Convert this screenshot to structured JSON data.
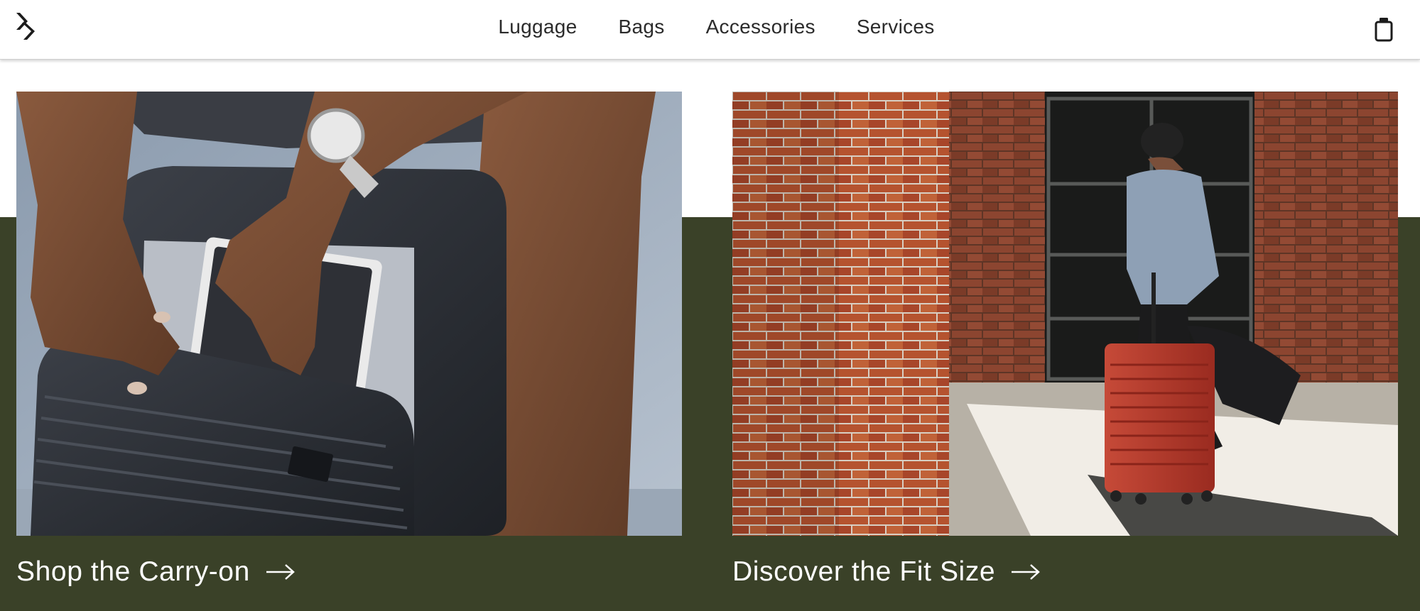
{
  "header": {
    "logo_icon": "brand-logo-icon",
    "nav": [
      {
        "label": "Luggage"
      },
      {
        "label": "Bags"
      },
      {
        "label": "Accessories"
      },
      {
        "label": "Services"
      }
    ],
    "cart_icon": "shopping-bag-icon"
  },
  "promos": [
    {
      "label": "Shop the Carry-on",
      "image": "person-packing-black-carry-on-suitcase",
      "arrow_icon": "arrow-right-icon"
    },
    {
      "label": "Discover the Fit Size",
      "image": "man-pulling-red-suitcase-past-brick-building",
      "arrow_icon": "arrow-right-icon"
    }
  ],
  "colors": {
    "band": "#3a4128",
    "header_bg": "#ffffff",
    "nav_text": "#2b2b2b",
    "cta_text": "#ffffff",
    "suitcase_red": "#b5382a",
    "suitcase_black": "#2a2d33"
  }
}
